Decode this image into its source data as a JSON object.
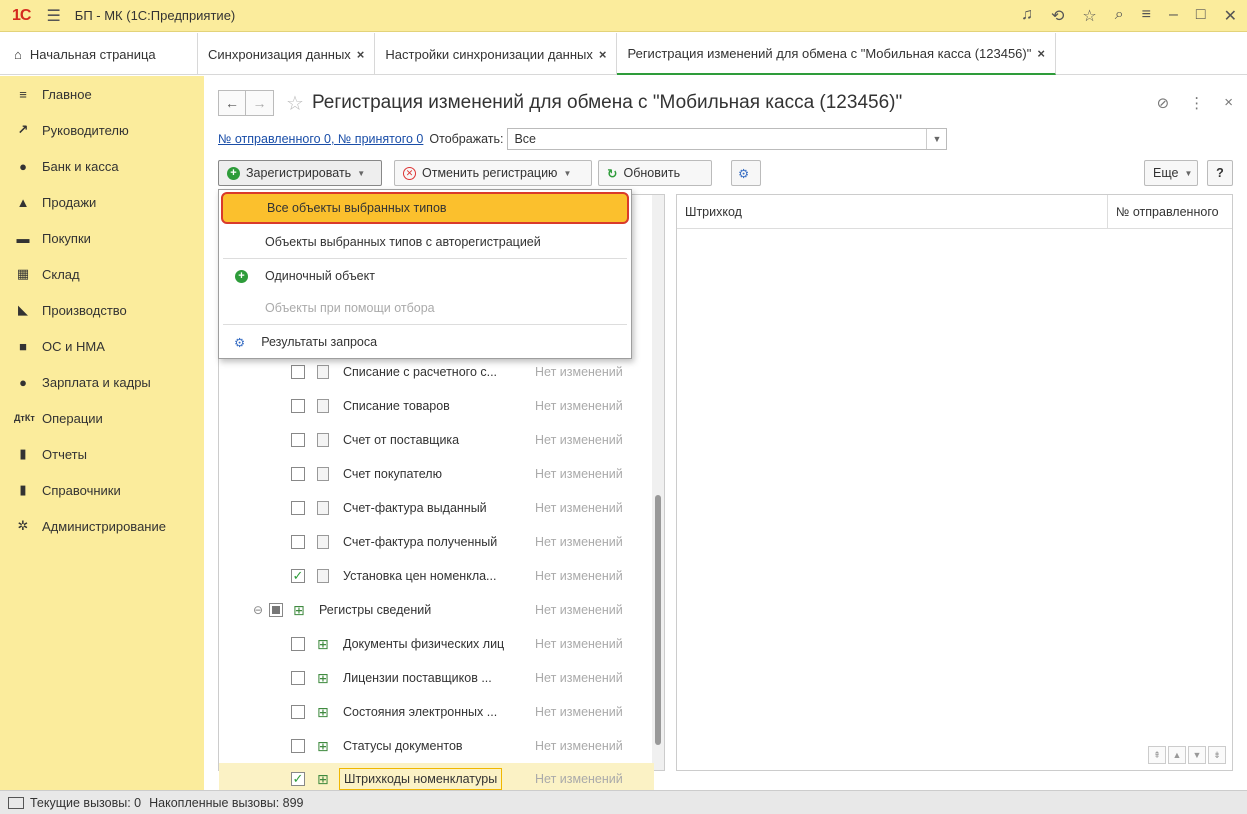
{
  "titlebar": {
    "logo": "1С",
    "title": "БП - МК  (1С:Предприятие)"
  },
  "tabs": [
    {
      "label": "Начальная страница",
      "closable": false
    },
    {
      "label": "Синхронизация данных",
      "closable": true
    },
    {
      "label": "Настройки синхронизации данных",
      "closable": true
    },
    {
      "label": "Регистрация изменений для обмена с  \"Мобильная касса (123456)\"",
      "closable": true
    }
  ],
  "sidebar": {
    "items": [
      {
        "label": "Главное",
        "icon": "menu-icon"
      },
      {
        "label": "Руководителю",
        "icon": "chart-line-icon"
      },
      {
        "label": "Банк и касса",
        "icon": "bank-icon"
      },
      {
        "label": "Продажи",
        "icon": "cart-sell-icon"
      },
      {
        "label": "Покупки",
        "icon": "cart-icon"
      },
      {
        "label": "Склад",
        "icon": "warehouse-icon"
      },
      {
        "label": "Производство",
        "icon": "factory-icon"
      },
      {
        "label": "ОС и НМА",
        "icon": "truck-icon"
      },
      {
        "label": "Зарплата и кадры",
        "icon": "person-icon"
      },
      {
        "label": "Операции",
        "icon": "dt-kt-icon"
      },
      {
        "label": "Отчеты",
        "icon": "bar-chart-icon"
      },
      {
        "label": "Справочники",
        "icon": "book-icon"
      },
      {
        "label": "Администрирование",
        "icon": "gear-icon"
      }
    ]
  },
  "page": {
    "title": "Регистрация изменений для обмена с  \"Мобильная касса (123456)\"",
    "sent_received_link": "№ отправленного 0, № принятого 0",
    "display_label": "Отображать:",
    "display_value": "Все"
  },
  "toolbar": {
    "register_label": "Зарегистрировать",
    "cancel_label": "Отменить регистрацию",
    "refresh_label": "Обновить",
    "more_label": "Еще",
    "help_label": "?"
  },
  "dropdown": {
    "items": [
      {
        "label": "Все объекты выбранных типов",
        "state": "highlighted"
      },
      {
        "label": "Объекты выбранных типов с авторегистрацией",
        "state": "normal"
      },
      {
        "label": "Одиночный объект",
        "state": "normal"
      },
      {
        "label": "Объекты при помощи отбора",
        "state": "disabled"
      },
      {
        "label": "Результаты запроса",
        "state": "normal"
      }
    ]
  },
  "tree": {
    "rows": [
      {
        "name": "Списание с расчетного с...",
        "status": "Нет изменений",
        "checked": false,
        "kind": "doc"
      },
      {
        "name": "Списание товаров",
        "status": "Нет изменений",
        "checked": false,
        "kind": "doc"
      },
      {
        "name": "Счет от поставщика",
        "status": "Нет изменений",
        "checked": false,
        "kind": "doc"
      },
      {
        "name": "Счет покупателю",
        "status": "Нет изменений",
        "checked": false,
        "kind": "doc"
      },
      {
        "name": "Счет-фактура выданный",
        "status": "Нет изменений",
        "checked": false,
        "kind": "doc"
      },
      {
        "name": "Счет-фактура полученный",
        "status": "Нет изменений",
        "checked": false,
        "kind": "doc"
      },
      {
        "name": "Установка цен номенкла...",
        "status": "Нет изменений",
        "checked": true,
        "kind": "doc"
      },
      {
        "name": "Регистры сведений",
        "status": "Нет изменений",
        "checked": false,
        "kind": "group"
      },
      {
        "name": "Документы физических лиц",
        "status": "Нет изменений",
        "checked": false,
        "kind": "reg"
      },
      {
        "name": "Лицензии поставщиков ...",
        "status": "Нет изменений",
        "checked": false,
        "kind": "reg"
      },
      {
        "name": "Состояния электронных ...",
        "status": "Нет изменений",
        "checked": false,
        "kind": "reg"
      },
      {
        "name": "Статусы документов",
        "status": "Нет изменений",
        "checked": false,
        "kind": "reg"
      },
      {
        "name": "Штрихкоды номенклатуры",
        "status": "Нет изменений",
        "checked": true,
        "kind": "reg"
      }
    ]
  },
  "right_table": {
    "columns": [
      "Штрихкод",
      "№ отправленного"
    ]
  },
  "statusbar": {
    "current_calls": "Текущие вызовы: 0",
    "accumulated_calls": "Накопленные вызовы: 899"
  }
}
